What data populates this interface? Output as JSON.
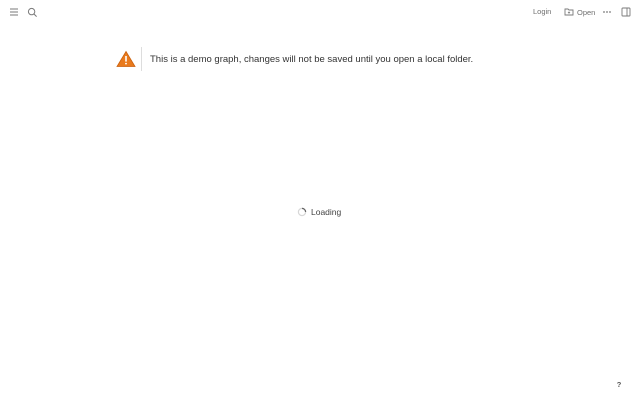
{
  "header": {
    "left_icons": [
      "menu-icon",
      "search-icon"
    ],
    "login_label": "Login",
    "open_label": "Open",
    "open_icon": "folder-open-icon",
    "more_icon": "more-horizontal-icon",
    "sidebar_icon": "right-sidebar-icon"
  },
  "notice": {
    "icon": "warning-icon",
    "text": "This is a demo graph, changes will not be saved until you open a local folder."
  },
  "loading": {
    "text": "Loading"
  },
  "help": {
    "label": "?"
  },
  "colors": {
    "warning": "#e97a1c",
    "divider": "#dddddd",
    "muted": "#7a7a7a",
    "text": "#333333"
  }
}
